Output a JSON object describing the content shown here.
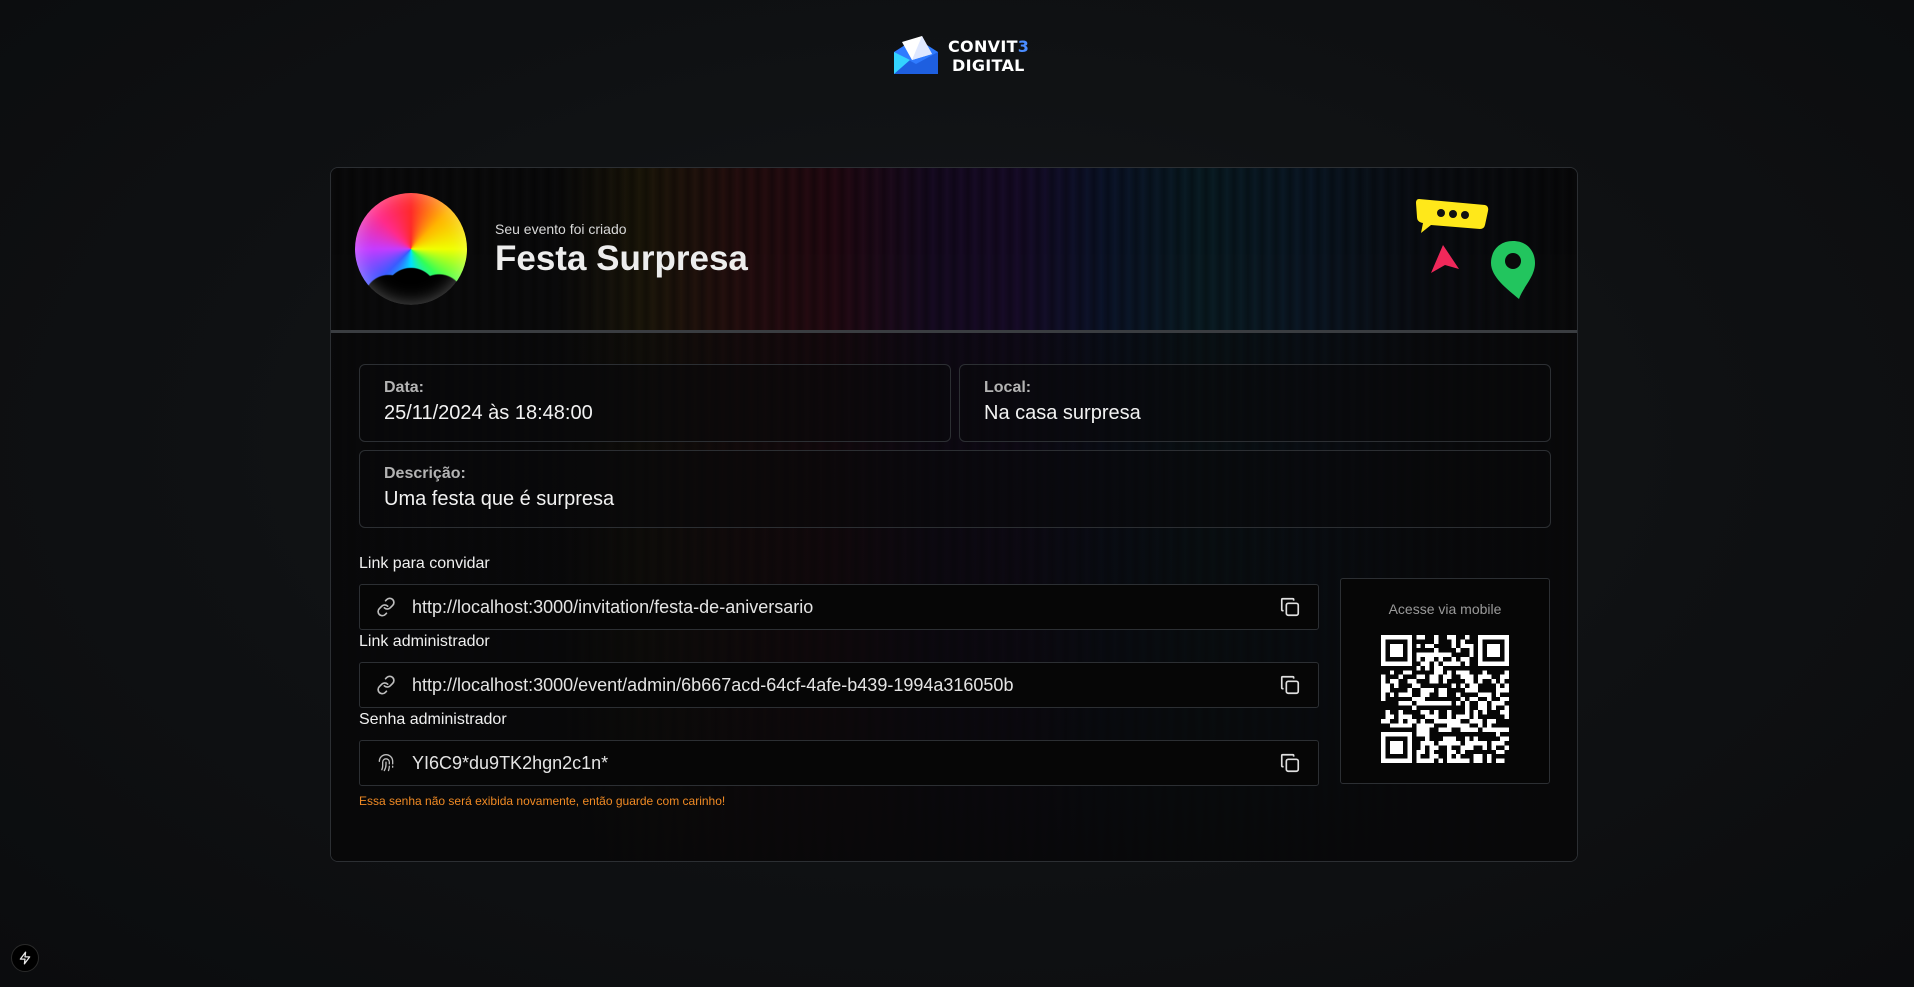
{
  "brand": {
    "name_line1_prefix": "CONVIT",
    "name_line1_accent": "3",
    "name_line2": "DIGITAL",
    "icon": "envelope-logo-icon"
  },
  "event": {
    "subtitle": "Seu evento foi criado",
    "title": "Festa Surpresa",
    "avatar": "party-crowd-image"
  },
  "details": {
    "date": {
      "label": "Data:",
      "value": "25/11/2024 às 18:48:00"
    },
    "location": {
      "label": "Local:",
      "value": "Na casa surpresa"
    },
    "description": {
      "label": "Descrição:",
      "value": "Uma festa que é surpresa"
    }
  },
  "links": {
    "invite": {
      "label": "Link para convidar",
      "value": "http://localhost:3000/invitation/festa-de-aniversario",
      "icon": "link-icon"
    },
    "admin": {
      "label": "Link administrador",
      "value": "http://localhost:3000/event/admin/6b667acd-64cf-4afe-b439-1994a316050b",
      "icon": "link-icon"
    },
    "password": {
      "label": "Senha administrador",
      "value": "YI6C9*du9TK2hgn2c1n*",
      "icon": "fingerprint-icon"
    },
    "warning": "Essa senha não será exibida novamente, então guarde com carinho!"
  },
  "qr": {
    "label": "Acesse via mobile"
  },
  "colors": {
    "background": "#0f1113",
    "card_border": "#2c2f33",
    "warning": "#f08a24",
    "accent_yellow": "#ffe81a",
    "accent_pink": "#f0285a",
    "accent_green": "#22c55e",
    "brand_blue": "#4a8cff"
  }
}
